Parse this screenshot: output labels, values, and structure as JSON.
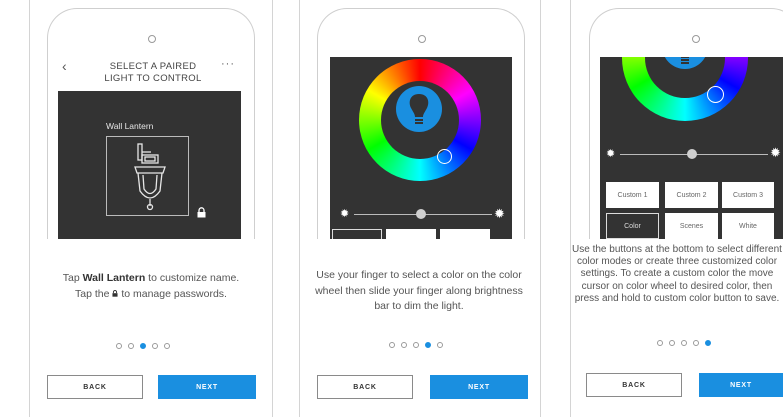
{
  "panels": [
    {
      "header_title": "SELECT A PAIRED\nLIGHT TO CONTROL",
      "device_name": "Wall Lantern",
      "desc_pre": "Tap ",
      "desc_bold": "Wall Lantern",
      "desc_post": " to customize name.",
      "desc_line2_pre": "Tap the ",
      "desc_line2_post": " to manage passwords.",
      "back_label": "BACK",
      "next_label": "NEXT",
      "active_step": 3,
      "steps": 5
    },
    {
      "desc": "Use your finger to select a color on the color wheel then slide your finger along brightness bar to dim the light.",
      "back_label": "BACK",
      "next_label": "NEXT",
      "active_step": 4,
      "steps": 5
    },
    {
      "custom_buttons": [
        "Custom 1",
        "Custom 2",
        "Custom 3"
      ],
      "mode_buttons": [
        "Color",
        "Scenes",
        "White"
      ],
      "desc": "Use the buttons at the bottom to select different color modes or create three customized color settings. To create a custom color the move cursor on color wheel to desired color, then press and hold to custom color button to save.",
      "back_label": "BACK",
      "next_label": "NEXT",
      "active_step": 5,
      "steps": 5
    }
  ],
  "colors": {
    "accent": "#1a8fe0",
    "screen": "#333333"
  }
}
